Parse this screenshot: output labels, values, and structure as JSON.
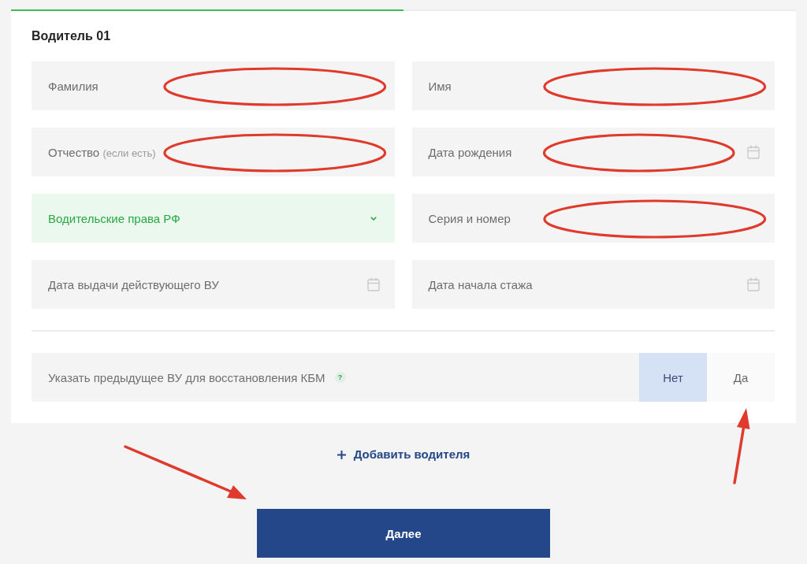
{
  "progress": {
    "level": 0.5
  },
  "driver": {
    "title": "Водитель 01",
    "fields": [
      {
        "kind": "text",
        "placeholder": "Фамилия",
        "circled": true
      },
      {
        "kind": "text",
        "placeholder": "Имя",
        "circled": true
      },
      {
        "kind": "text",
        "placeholder": "Отчество",
        "note": "(если есть)",
        "circled": true
      },
      {
        "kind": "date",
        "placeholder": "Дата рождения",
        "circled": true
      },
      {
        "kind": "select",
        "value": "Водительские права РФ",
        "circled": false
      },
      {
        "kind": "text",
        "placeholder": "Серия и номер",
        "circled": true
      },
      {
        "kind": "date",
        "placeholder": "Дата выдачи действующего ВУ",
        "circled": false
      },
      {
        "kind": "date",
        "placeholder": "Дата начала стажа",
        "circled": false
      }
    ],
    "kbm_toggle": {
      "label": "Указать предыдущее ВУ для восстановления КБМ",
      "help": "?",
      "options": [
        {
          "label": "Нет",
          "selected": true,
          "arrow": false
        },
        {
          "label": "Да",
          "selected": false,
          "arrow": true
        }
      ]
    }
  },
  "add_driver": {
    "label": "Добавить водителя"
  },
  "next_button": {
    "label": "Далее",
    "arrow": true
  }
}
